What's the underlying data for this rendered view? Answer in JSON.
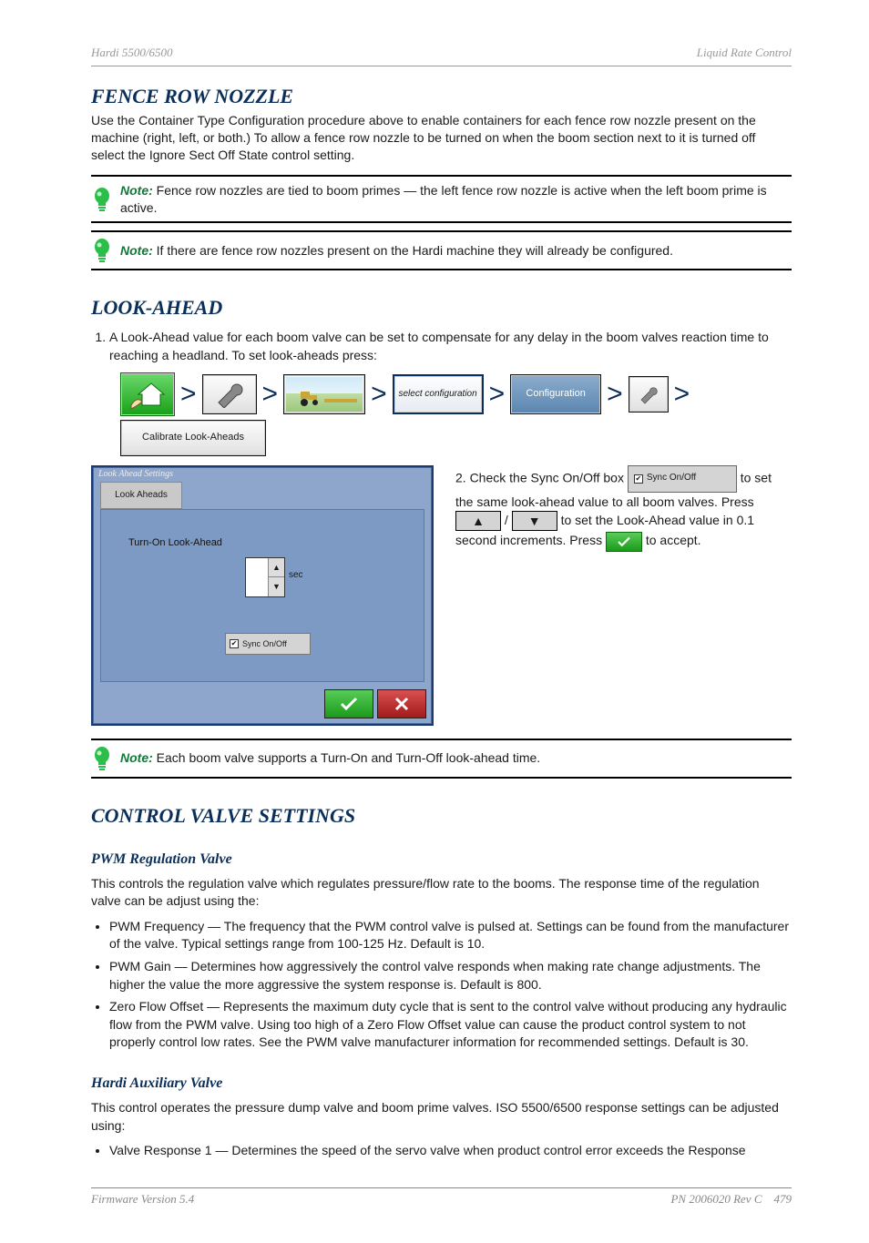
{
  "header": {
    "left": "Hardi 5500/6500",
    "right": "Liquid Rate Control"
  },
  "h_fence": "FENCE ROW NOZZLE",
  "intro_fence": "Use the Container Type Configuration procedure above to enable containers for each fence row nozzle present on the machine (right, left, or both.) To allow a fence row nozzle to be turned on when the boom section next to it is turned off select the Ignore Sect Off State control setting.",
  "note1": {
    "bold": "Note:",
    "text": " Fence row nozzles are tied to boom primes — the left fence row nozzle is active when the left boom prime is active."
  },
  "note2": {
    "bold": "Note:",
    "text": " If there are fence row nozzles present on the Hardi machine they will already be configured."
  },
  "h_lookahead": "LOOK-AHEAD",
  "steps": {
    "s1_a": "A Look-Ahead value for each boom valve can be set to compensate for any delay in the boom valves reaction time to reaching a headland. To set look-aheads press:",
    "crumb": {
      "home_alt": "Home",
      "wrench_alt": "Setup",
      "config_label": "Configuration",
      "select_text": "select configuration",
      "wrench2_alt": "Setup",
      "cal_label": "Calibrate Look-Aheads"
    },
    "dlg": {
      "title": "Look Ahead Settings",
      "tab": "Look Aheads",
      "label": "Turn-On Look-Ahead",
      "unit": "sec",
      "chk": "Sync On/Off"
    },
    "s2": {
      "pre": "2. Check the Sync On/Off box ",
      "chk": "Sync On/Off",
      "mid1": " to set the same look-ahead value to all boom valves. Press ",
      "mid2": " /  ",
      "mid3": " to set the Look-Ahead value in 0.1 second increments. Press ",
      "post": " to accept."
    }
  },
  "note3": {
    "bold": "Note:",
    "text": " Each boom valve supports a Turn-On and Turn-Off look-ahead time."
  },
  "h_control": "CONTROL VALVE SETTINGS",
  "h_pwm": "PWM Regulation Valve",
  "pwm_intro": "This controls the regulation valve which regulates pressure/flow rate to the booms. The response time of the regulation valve can be adjust using the:",
  "pwm_bullets": [
    "PWM Frequency — The frequency that the PWM control valve is pulsed at. Settings can be found from the manufacturer of the valve. Typical settings range from 100-125 Hz. Default is 10.",
    "PWM Gain — Determines how aggressively the control valve responds when making rate change adjustments. The higher the value the more aggressive the system response is. Default is 800.",
    "Zero Flow Offset — Represents the maximum duty cycle that is sent to the control valve without producing any hydraulic flow from the PWM valve. Using too high of a Zero Flow Offset value can cause the product control system to not properly control low rates. See the PWM valve manufacturer information for recommended settings. Default is 30."
  ],
  "h_aux": "Hardi Auxiliary Valve",
  "aux_intro": "This control operates the pressure dump valve and boom prime valves. ISO 5500/6500 response settings can be adjusted using:",
  "aux_bullets": [
    "Valve Response 1 — Determines the speed of the servo valve when product control error exceeds the Response"
  ],
  "footer": {
    "left": "Firmware Version 5.4",
    "right": "PN 2006020 Rev C",
    "page": "479"
  }
}
